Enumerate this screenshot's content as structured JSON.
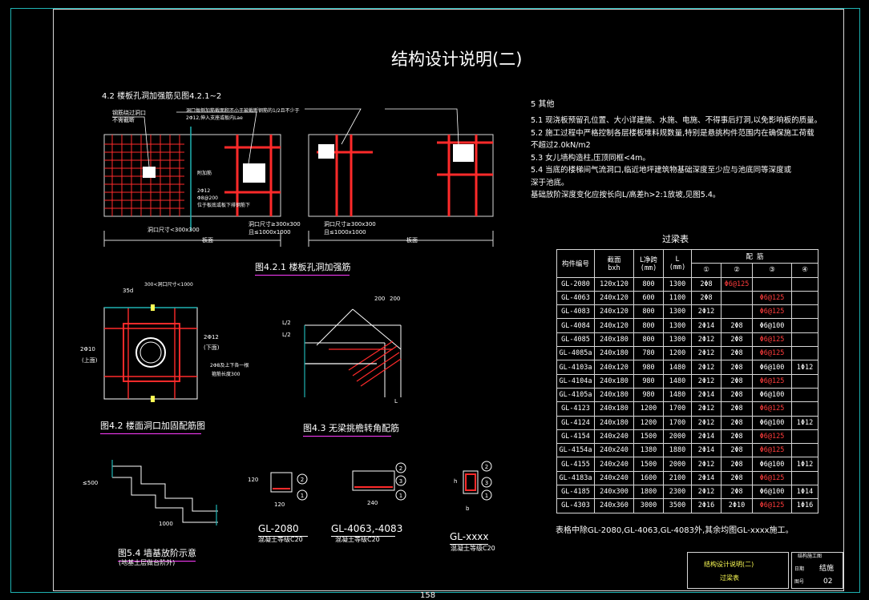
{
  "title": "结构设计说明(二)",
  "page_number": "158",
  "sec42": {
    "heading": "4.2  楼板孔洞加强筋见图4.2.1~2",
    "fig421": "图4.2.1  楼板孔洞加强筋",
    "fig422": "图4.2 楼面洞口加固配筋图",
    "fig43": "图4.3 无梁挑檐转角配筋",
    "fig54": "图5.4 墙基放阶示意",
    "fig54_sub": "(地基土层做台阶外)"
  },
  "plan_labels": {
    "a1": "洞口尺寸<300x300",
    "a2": "板面",
    "a3": "洞口尺寸≥300x300",
    "a4": "且≤1000x1000",
    "b1": "洞口尺寸≥300x300",
    "b2": "且≤1000x1000",
    "b3": "板面",
    "n1": "钢筋绕过洞口",
    "n2": "不需截断",
    "n3": "洞口每侧加筋截面积不小于被截断钢筋的1/2且不少于",
    "n4": "2Φ12,伸入支座或板内Lae",
    "n5": "附加筋",
    "n6": "2Φ12",
    "n7": "Φ8@200",
    "n8": "位于板底或板下排钢筋下"
  },
  "hole_labels": {
    "h1": "35d",
    "h2": "300<洞口尺寸<1000",
    "h3": "2Φ10",
    "h4": "(上面)",
    "h5": "2Φ12",
    "h6": "(下面)",
    "h7": "2Φ8及上下各一根",
    "h8": "箍筋长度300"
  },
  "eave_labels": {
    "e1": "200",
    "e2": "200",
    "e3": "L/2",
    "e4": "L/2",
    "e5": "L"
  },
  "step_labels": {
    "s1": "≤500",
    "s2": "1000"
  },
  "sections": [
    {
      "name": "GL-2080",
      "note": "混凝土等级C20",
      "w": "120",
      "h": "120"
    },
    {
      "name": "GL-4063,-4083",
      "note": "混凝土等级C20",
      "w": "240"
    },
    {
      "name": "GL-xxxx",
      "note": "混凝土等级C20",
      "w": "b",
      "h": "h"
    }
  ],
  "notes": {
    "heading": "5  其他",
    "items": [
      "5.1  现浇板预留孔位置、大小详建施、水施、电施、不得事后打洞,以免影响板的质量。",
      "5.2  施工过程中严格控制各层楼板堆料规数量,特别是悬挑构件范围内在确保施工荷载",
      "       不超过2.0kN/m2",
      "5.3  女儿墙构造柱,压顶同框<4m。",
      "5.4  当底的楼梯间气流洞口,临近地坪建筑物基础深度至少应与池底同等深度或",
      "       深于池底。",
      "       基础放阶深度变化应按长向L/高差h>2:1放坡,见图5.4。"
    ],
    "footer": "表格中除GL-2080,GL-4063,GL-4083外,其余均图GL-xxxx施工。"
  },
  "lintel_table": {
    "title": "过梁表",
    "headers": {
      "code": "构件编号",
      "section": "截面",
      "section2": "bxh",
      "span": "L净跨",
      "span2": "(mm)",
      "len": "L",
      "len2": "(mm)",
      "rebar": "配    筋",
      "c1": "①",
      "c2": "②",
      "c3": "③",
      "c4": "④"
    },
    "rows": [
      [
        "GL-2080",
        "120x120",
        "800",
        "1300",
        "2Φ8",
        "Φ6@125",
        "",
        ""
      ],
      [
        "GL-4063",
        "240x120",
        "600",
        "1100",
        "2Φ8",
        "",
        "Φ6@125",
        ""
      ],
      [
        "GL-4083",
        "240x120",
        "800",
        "1300",
        "2Φ12",
        "",
        "Φ6@125",
        ""
      ],
      [
        "GL-4084",
        "240x120",
        "800",
        "1300",
        "2Φ14",
        "2Φ8",
        "Φ6@100",
        ""
      ],
      [
        "GL-4085",
        "240x180",
        "800",
        "1300",
        "2Φ12",
        "2Φ8",
        "Φ6@125",
        ""
      ],
      [
        "GL-4085a",
        "240x180",
        "780",
        "1200",
        "2Φ12",
        "2Φ8",
        "Φ6@125",
        ""
      ],
      [
        "GL-4103a",
        "240x120",
        "980",
        "1480",
        "2Φ12",
        "2Φ8",
        "Φ6@100",
        "1Φ12"
      ],
      [
        "GL-4104a",
        "240x180",
        "980",
        "1480",
        "2Φ12",
        "2Φ8",
        "Φ6@125",
        ""
      ],
      [
        "GL-4105a",
        "240x180",
        "980",
        "1480",
        "2Φ14",
        "2Φ8",
        "Φ6@100",
        ""
      ],
      [
        "GL-4123",
        "240x180",
        "1200",
        "1700",
        "2Φ12",
        "2Φ8",
        "Φ6@125",
        ""
      ],
      [
        "GL-4124",
        "240x180",
        "1200",
        "1700",
        "2Φ12",
        "2Φ8",
        "Φ6@100",
        "1Φ12"
      ],
      [
        "GL-4154",
        "240x240",
        "1500",
        "2000",
        "2Φ14",
        "2Φ8",
        "Φ6@125",
        ""
      ],
      [
        "GL-4154a",
        "240x240",
        "1380",
        "1880",
        "2Φ14",
        "2Φ8",
        "Φ6@125",
        ""
      ],
      [
        "GL-4155",
        "240x240",
        "1500",
        "2000",
        "2Φ12",
        "2Φ8",
        "Φ6@100",
        "1Φ12"
      ],
      [
        "GL-4183a",
        "240x240",
        "1600",
        "2100",
        "2Φ14",
        "2Φ8",
        "Φ6@125",
        ""
      ],
      [
        "GL-4185",
        "240x300",
        "1800",
        "2300",
        "2Φ12",
        "2Φ8",
        "Φ6@100",
        "1Φ14"
      ],
      [
        "GL-4303",
        "240x360",
        "3000",
        "3500",
        "2Φ16",
        "2Φ10",
        "Φ6@125",
        "1Φ16"
      ]
    ]
  },
  "title_block": {
    "name": "结构设计说明(二)",
    "sub": "过梁表",
    "r1": "结构施工图",
    "r2": "日期",
    "r3": "图号",
    "r4": "结施",
    "r5": "02"
  },
  "colors": {
    "frame": "#1fb3b3",
    "rebar": "#ff2a2a",
    "caption": "#ff3cff",
    "text": "#ffffff",
    "highlight": "#ffff55"
  }
}
